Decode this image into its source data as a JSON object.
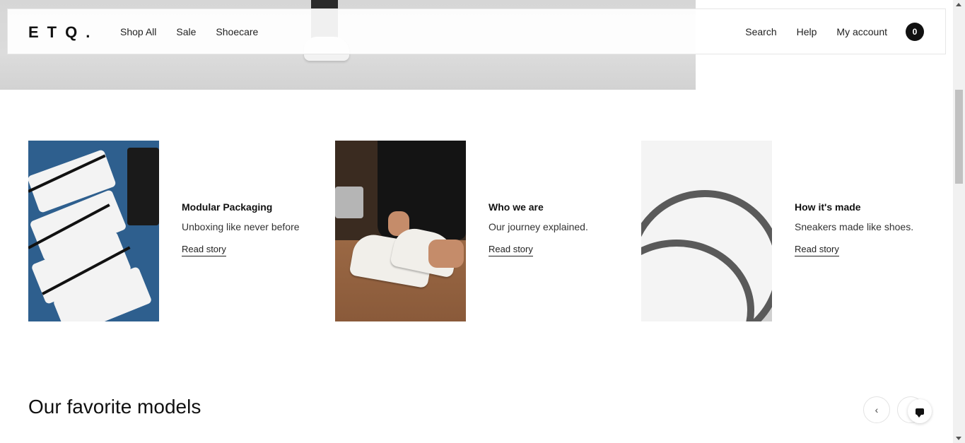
{
  "brand": {
    "logo": "ETQ."
  },
  "nav": {
    "left": [
      "Shop All",
      "Sale",
      "Shoecare"
    ],
    "right": [
      "Search",
      "Help",
      "My account"
    ],
    "cart_count": "0"
  },
  "stories": [
    {
      "title": "Modular Packaging",
      "subtitle": "Unboxing like never before",
      "link": "Read story"
    },
    {
      "title": "Who we are",
      "subtitle": "Our journey explained.",
      "link": "Read story"
    },
    {
      "title": "How it's made",
      "subtitle": "Sneakers made like shoes.",
      "link": "Read story"
    }
  ],
  "favorites": {
    "title": "Our favorite models",
    "prev_icon": "‹",
    "next_icon": "›"
  },
  "icons": [
    "chevron-left-icon",
    "chevron-right-icon",
    "chat-icon"
  ],
  "colors": {
    "text": "#111111",
    "cart_bg": "#111111",
    "accent": "#ffffff"
  }
}
